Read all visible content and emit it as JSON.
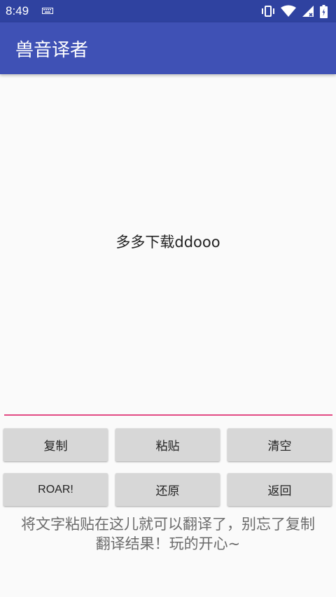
{
  "status_bar": {
    "time": "8:49",
    "icons": [
      "keyboard-icon",
      "vibrate-icon",
      "wifi-icon",
      "signal-icon",
      "battery-icon"
    ]
  },
  "app_bar": {
    "title": "兽音译者",
    "color": "#3f51b5"
  },
  "editor": {
    "text": "多多下载ddooo",
    "underline_color": "#e24a84"
  },
  "buttons": {
    "row1": [
      "复制",
      "粘贴",
      "清空"
    ],
    "row2": [
      "ROAR!",
      "还原",
      "返回"
    ]
  },
  "hint": {
    "line1": "将文字粘贴在这儿就可以翻译了，别忘了复制",
    "line2": "翻译结果！玩的开心~"
  }
}
